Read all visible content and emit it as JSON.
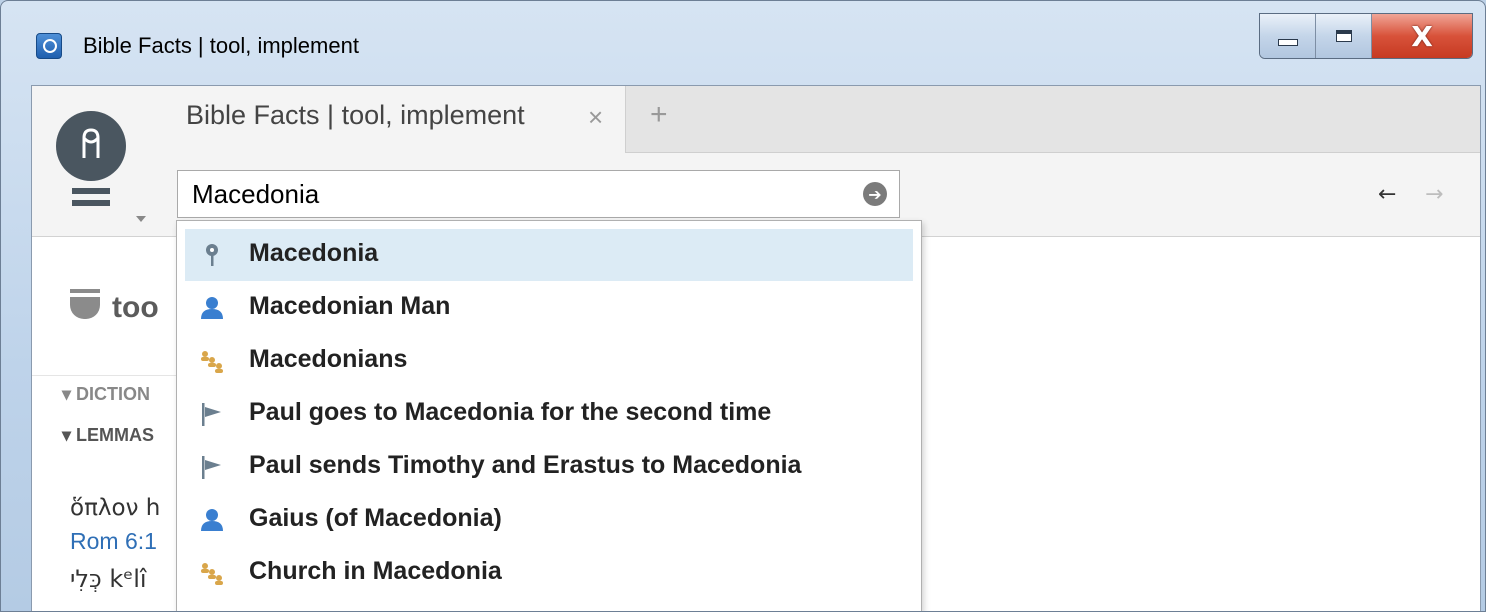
{
  "window": {
    "title": "Bible Facts | tool, implement"
  },
  "tabs": {
    "active_label": "Bible Facts | tool, implement",
    "close_glyph": "×",
    "add_glyph": "+"
  },
  "search": {
    "value": "Macedonia",
    "go_glyph": "➔"
  },
  "nav": {
    "back_glyph": "←",
    "forward_glyph": "→"
  },
  "content": {
    "heading": "too",
    "sections": [
      "DICTION",
      "LEMMAS"
    ],
    "lemma1": "ὅπλον h",
    "ref1": "Rom 6:1",
    "lemma2": "כְּלִי kᵉlî"
  },
  "suggestions": [
    {
      "label": "Macedonia",
      "icon": "place-pin-icon"
    },
    {
      "label": "Macedonian Man",
      "icon": "person-icon"
    },
    {
      "label": "Macedonians",
      "icon": "group-icon"
    },
    {
      "label": "Paul goes to Macedonia for the second time",
      "icon": "event-flag-icon"
    },
    {
      "label": "Paul sends Timothy and Erastus to Macedonia",
      "icon": "event-flag-icon"
    },
    {
      "label": "Gaius (of Macedonia)",
      "icon": "person-icon"
    },
    {
      "label": "Church in Macedonia",
      "icon": "group-icon"
    }
  ],
  "colors": {
    "selected_row": "#dcebf5",
    "link": "#2f6fb6",
    "person_icon": "#3a7fd0",
    "group_icon": "#d9a64a",
    "pin_icon": "#6b7f8f"
  }
}
